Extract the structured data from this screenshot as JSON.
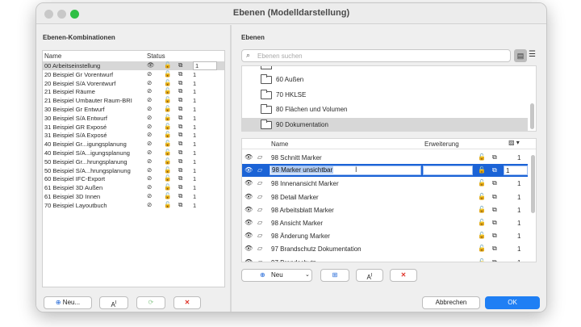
{
  "window": {
    "title": "Ebenen (Modelldarstellung)"
  },
  "left_panel": {
    "heading": "Ebenen-Kombinationen",
    "col_name": "Name",
    "col_status": "Status",
    "rows": [
      {
        "name": "00 Arbeitseinstellung",
        "num": "1"
      },
      {
        "name": "20 Beispiel Gr Vorentwurf",
        "num": "1"
      },
      {
        "name": "20 Beispiel S/A Vorentwurf",
        "num": "1"
      },
      {
        "name": "21 Beispiel Räume",
        "num": "1"
      },
      {
        "name": "21 Beispiel Umbauter Raum-BRI",
        "num": "1"
      },
      {
        "name": "30 Beispiel Gr Entwurf",
        "num": "1"
      },
      {
        "name": "30 Beispiel S/A Entwurf",
        "num": "1"
      },
      {
        "name": "31 Beispiel GR Exposé",
        "num": "1"
      },
      {
        "name": "31 Beispiel S/A Exposé",
        "num": "1"
      },
      {
        "name": "40 Beispiel Gr...igungsplanung",
        "num": "1"
      },
      {
        "name": "40 Beispiel S/A...igungsplanung",
        "num": "1"
      },
      {
        "name": "50 Beispiel Gr...hrungsplanung",
        "num": "1"
      },
      {
        "name": "50 Beispiel S/A...hrungsplanung",
        "num": "1"
      },
      {
        "name": "60 Beispiel IFC-Export",
        "num": "1"
      },
      {
        "name": "61 Beispiel 3D Außen",
        "num": "1"
      },
      {
        "name": "61 Beispiel 3D Innen",
        "num": "1"
      },
      {
        "name": "70 Beispiel Layoutbuch",
        "num": "1"
      }
    ],
    "new_label": "Neu..."
  },
  "right_panel": {
    "heading": "Ebenen",
    "search_placeholder": "Ebenen suchen",
    "folders": [
      {
        "label": "60 Außen"
      },
      {
        "label": "70 HKLSE"
      },
      {
        "label": "80 Flächen und Volumen"
      },
      {
        "label": "90 Dokumentation"
      }
    ],
    "col_name": "Name",
    "col_ext": "Erweiterung",
    "layers": [
      {
        "name": "98 Schnitt Marker",
        "num": "1"
      },
      {
        "name": "98 Marker unsichtbar",
        "num": "1"
      },
      {
        "name": "98 Innenansicht Marker",
        "num": "1"
      },
      {
        "name": "98 Detail Marker",
        "num": "1"
      },
      {
        "name": "98 Arbeitsblatt Marker",
        "num": "1"
      },
      {
        "name": "98 Ansicht Marker",
        "num": "1"
      },
      {
        "name": "98 Änderung Marker",
        "num": "1"
      },
      {
        "name": "97 Brandschutz Dokumentation",
        "num": "1"
      },
      {
        "name": "97 Brandschutz",
        "num": "1"
      }
    ],
    "new_label": "Neu"
  },
  "footer": {
    "cancel": "Abbrechen",
    "ok": "OK"
  },
  "colors": {
    "accent": "#1b63d6",
    "ok_button": "#1f7ff4",
    "delete": "#e0352b"
  }
}
